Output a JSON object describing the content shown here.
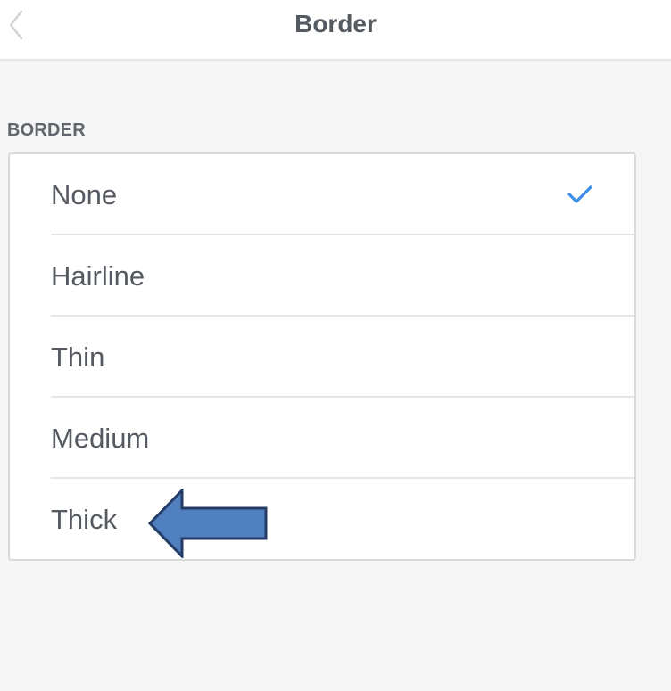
{
  "header": {
    "title": "Border",
    "back_icon": "chevron-left-icon"
  },
  "section": {
    "label": "BORDER"
  },
  "options": [
    {
      "label": "None",
      "selected": true
    },
    {
      "label": "Hairline",
      "selected": false
    },
    {
      "label": "Thin",
      "selected": false
    },
    {
      "label": "Medium",
      "selected": false
    },
    {
      "label": "Thick",
      "selected": false
    }
  ],
  "colors": {
    "accent": "#3e8ee8",
    "annotation_arrow_fill": "#4f7fbf",
    "annotation_arrow_stroke": "#243b63"
  }
}
